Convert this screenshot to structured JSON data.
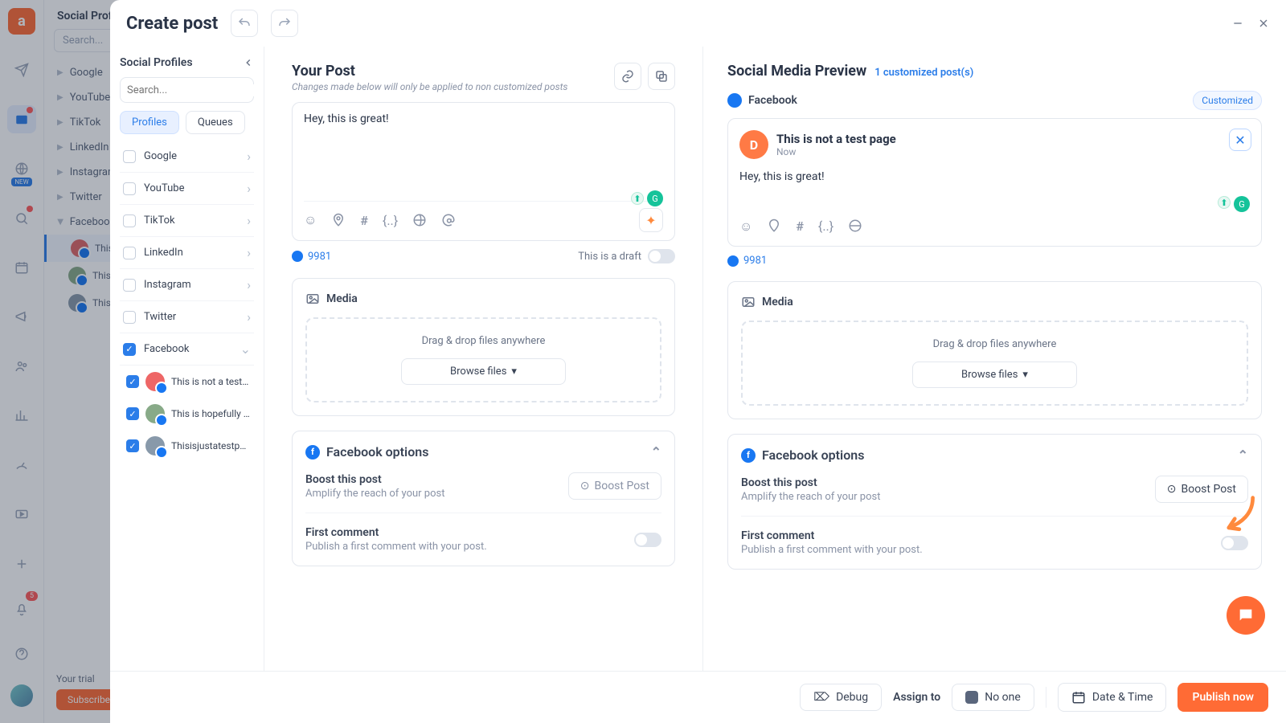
{
  "bg": {
    "col2_title": "Social Profiles",
    "search_ph": "Search...",
    "networks": [
      "Google",
      "YouTube",
      "TikTok",
      "LinkedIn",
      "Instagram",
      "Twitter",
      "Facebook"
    ],
    "fb_pages": [
      "This is not a test page",
      "This is hopefully a classic",
      "Thisisjustatestpage"
    ],
    "trial": "Your trial",
    "trial_btn": "Subscribe"
  },
  "modal": {
    "title": "Create post",
    "profiles": {
      "title": "Social Profiles",
      "search_ph": "Search...",
      "tab_profiles": "Profiles",
      "tab_queues": "Queues",
      "nets": [
        {
          "name": "Google",
          "checked": false
        },
        {
          "name": "YouTube",
          "checked": false
        },
        {
          "name": "TikTok",
          "checked": false
        },
        {
          "name": "LinkedIn",
          "checked": false
        },
        {
          "name": "Instagram",
          "checked": false
        },
        {
          "name": "Twitter",
          "checked": false
        },
        {
          "name": "Facebook",
          "checked": true
        }
      ],
      "fb_subs": [
        {
          "name": "This is not a test page"
        },
        {
          "name": "This is hopefully a classic"
        },
        {
          "name": "Thisisjustatestpage"
        }
      ]
    },
    "center": {
      "title": "Your Post",
      "subtitle": "Changes made below will only be applied to non customized posts",
      "compose_text": "Hey, this is great!",
      "char_count": "9981",
      "draft_label": "This is a draft",
      "media_title": "Media",
      "drop_text": "Drag & drop files anywhere",
      "browse": "Browse files",
      "fb_options": "Facebook options",
      "boost_title": "Boost this post",
      "boost_desc": "Amplify the reach of your post",
      "boost_btn": "Boost Post",
      "first_comment": "First comment",
      "first_comment_desc": "Publish a first comment with your post."
    },
    "right": {
      "title": "Social Media Preview",
      "link": "1 customized post(s)",
      "net_label": "Facebook",
      "customized": "Customized",
      "page_name": "This is not a test page",
      "page_time": "Now",
      "page_initial": "D",
      "body": "Hey, this is great!",
      "count": "9981",
      "media_title": "Media",
      "drop_text": "Drag & drop files anywhere",
      "browse": "Browse files",
      "fb_options": "Facebook options",
      "boost_title": "Boost this post",
      "boost_desc": "Amplify the reach of your post",
      "boost_btn": "Boost Post",
      "first_comment": "First comment",
      "first_comment_desc": "Publish a first comment with your post."
    },
    "footer": {
      "debug": "Debug",
      "assign": "Assign to",
      "noone": "No one",
      "datetime": "Date & Time",
      "publish": "Publish now"
    }
  }
}
